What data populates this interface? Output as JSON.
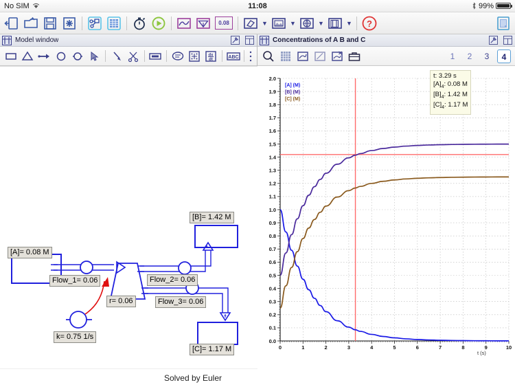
{
  "status_bar": {
    "carrier": "No SIM",
    "wifi_icon": "wifi-icon",
    "time": "11:08",
    "bluetooth_icon": "bluetooth-icon",
    "battery_percent": "99%"
  },
  "main_toolbar": {
    "buttons": [
      {
        "name": "open-model-icon",
        "label": ""
      },
      {
        "name": "new-folder-icon",
        "label": ""
      },
      {
        "name": "save-icon",
        "label": ""
      },
      {
        "name": "new-document-icon",
        "label": ""
      },
      {
        "name": "model-diagram-icon",
        "label": ""
      },
      {
        "name": "table-icon",
        "label": ""
      },
      {
        "name": "stopwatch-icon",
        "label": ""
      },
      {
        "name": "run-simulation-icon",
        "label": ""
      },
      {
        "name": "graph-icon",
        "label": ""
      },
      {
        "name": "gauge-icon",
        "label": ""
      },
      {
        "name": "value-display-icon",
        "label": "0.08"
      },
      {
        "name": "eraser-icon",
        "label": ""
      },
      {
        "name": "image-icon",
        "label": ""
      },
      {
        "name": "globe-icon",
        "label": ""
      },
      {
        "name": "copy-pages-icon",
        "label": ""
      },
      {
        "name": "help-icon",
        "label": ""
      },
      {
        "name": "notebook-icon",
        "label": ""
      }
    ],
    "value_badge": "0.08"
  },
  "model_pane": {
    "title": "Model window",
    "tools": [
      "rectangle-tool",
      "reservoir-tool",
      "flow-tool",
      "circle-tool",
      "valve-tool",
      "pointer-tool",
      "connector-tool",
      "scissors-tool",
      "text-box-tool",
      "comment-tool",
      "move-tool",
      "derivative-tool",
      "abc-tool",
      "more-tools"
    ],
    "footer_status": "Solved by Euler",
    "labels": {
      "a_stock": "[A]= 0.08 M",
      "b_stock": "[B]= 1.42 M",
      "c_stock": "[C]= 1.17 M",
      "flow1": "Flow_1= 0.06",
      "flow2": "Flow_2= 0.06",
      "flow3": "Flow_3= 0.06",
      "rate": "r= 0.06",
      "k_param": "k= 0.75 1/s"
    }
  },
  "chart_pane": {
    "title": "Concentrations of A B and C",
    "tools": [
      "zoom-icon",
      "grid-icon",
      "plot-settings-icon",
      "edit-plot-icon",
      "delete-plot-icon",
      "toolbox-icon"
    ],
    "pages": [
      "1",
      "2",
      "3",
      "4"
    ],
    "active_page": "4",
    "readout": {
      "time": "t: 3.29 s",
      "a": "[A]",
      "a_sub": "4",
      "a_val": ": 0.08 M",
      "b": "[B]",
      "b_sub": "4",
      "b_val": ": 1.42 M",
      "c": "[C]",
      "c_sub": "4",
      "c_val": ": 1.17 M"
    }
  },
  "colors": {
    "series_a": "#1a1ae6",
    "series_b": "#4a2a9c",
    "series_c": "#8a5a1e",
    "cursor_line": "#ff6b6b",
    "grid": "#b9b9b9",
    "model_stroke": "#2020dd",
    "model_red": "#e01010",
    "toolbar_blue": "#3b5ba8"
  },
  "chart_data": {
    "type": "line",
    "title": "Concentrations of A B and C",
    "xlabel": "t (s)",
    "ylabel": "",
    "xlim": [
      0,
      10
    ],
    "ylim": [
      0,
      2.0
    ],
    "xticks": [
      0,
      1,
      2,
      3,
      4,
      5,
      6,
      7,
      8,
      9,
      10
    ],
    "yticks": [
      0.0,
      0.1,
      0.2,
      0.3,
      0.4,
      0.5,
      0.6,
      0.7,
      0.8,
      0.9,
      1.0,
      1.1,
      1.2,
      1.3,
      1.4,
      1.5,
      1.6,
      1.7,
      1.8,
      1.9,
      2.0
    ],
    "grid": true,
    "legend_position": "top-left",
    "cursor": {
      "t": 3.29,
      "value_line": 1.42
    },
    "x": [
      0,
      0.25,
      0.5,
      0.75,
      1.0,
      1.25,
      1.5,
      1.75,
      2.0,
      2.5,
      3.0,
      3.29,
      3.5,
      4.0,
      4.5,
      5.0,
      5.5,
      6.0,
      6.5,
      7.0,
      7.5,
      8.0,
      8.5,
      9.0,
      9.5,
      10.0
    ],
    "series": [
      {
        "name": "[A] (M)",
        "color": "#1a1ae6",
        "values": [
          1.0,
          0.83,
          0.69,
          0.57,
          0.47,
          0.39,
          0.325,
          0.27,
          0.223,
          0.154,
          0.105,
          0.085,
          0.073,
          0.05,
          0.034,
          0.0235,
          0.016,
          0.011,
          0.0076,
          0.0052,
          0.0036,
          0.0025,
          0.0017,
          0.0012,
          0.0008,
          0.0006
        ]
      },
      {
        "name": "[B] (M)",
        "color": "#4a2a9c",
        "values": [
          0.5,
          0.67,
          0.81,
          0.93,
          1.03,
          1.11,
          1.175,
          1.23,
          1.277,
          1.346,
          1.395,
          1.415,
          1.427,
          1.45,
          1.466,
          1.4765,
          1.484,
          1.489,
          1.4924,
          1.4948,
          1.4964,
          1.4975,
          1.4983,
          1.4988,
          1.4992,
          1.4994
        ]
      },
      {
        "name": "[C] (M)",
        "color": "#8a5a1e",
        "values": [
          0.25,
          0.42,
          0.56,
          0.68,
          0.78,
          0.86,
          0.925,
          0.98,
          1.027,
          1.096,
          1.145,
          1.165,
          1.177,
          1.2,
          1.216,
          1.2265,
          1.234,
          1.239,
          1.2424,
          1.2448,
          1.2464,
          1.2475,
          1.2483,
          1.2488,
          1.2492,
          1.2494
        ]
      }
    ]
  }
}
